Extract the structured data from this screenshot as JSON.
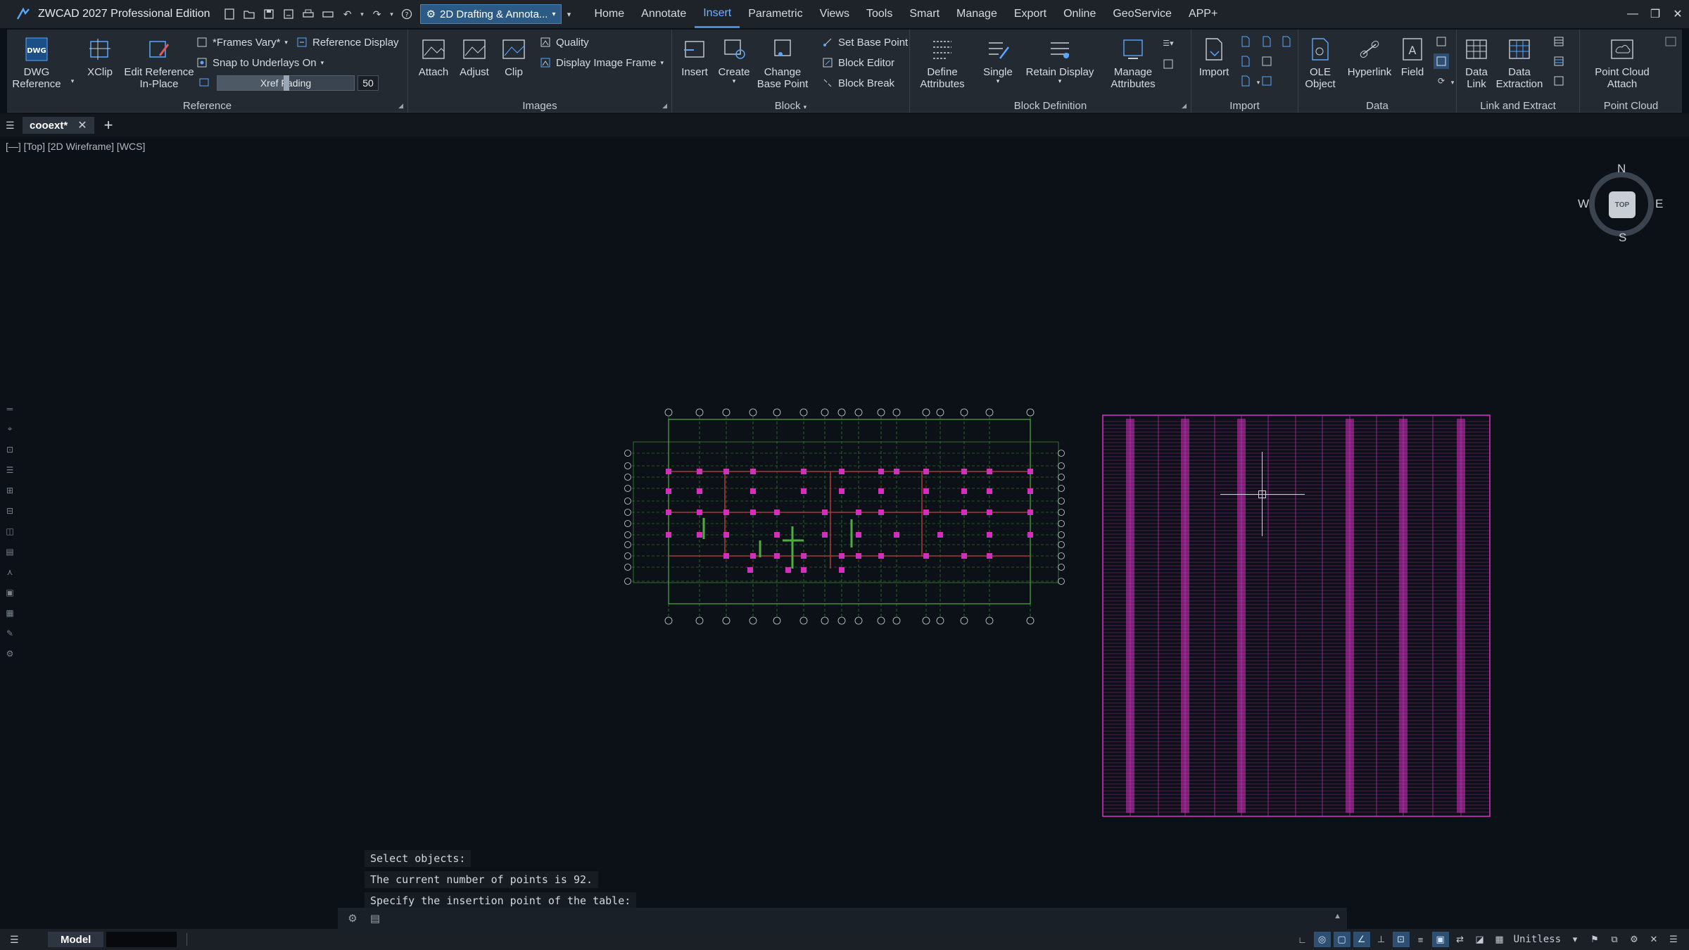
{
  "app": {
    "title": "ZWCAD 2027 Professional Edition"
  },
  "workspace": {
    "label": "2D Drafting & Annota..."
  },
  "menu": [
    "Home",
    "Annotate",
    "Insert",
    "Parametric",
    "Views",
    "Tools",
    "Smart",
    "Manage",
    "Export",
    "Online",
    "GeoService",
    "APP+"
  ],
  "menu_active": "Insert",
  "ribbon": {
    "reference": {
      "title": "Reference",
      "dwg_reference": "DWG\nReference",
      "xclip": "XClip",
      "edit_reference": "Edit Reference\nIn-Place",
      "frames": "*Frames Vary*",
      "reference_display": "Reference Display",
      "snap_underlays": "Snap to Underlays On",
      "xref_fading": {
        "label": "Xref Fading",
        "value": "50",
        "level_percent": 50
      }
    },
    "images": {
      "title": "Images",
      "attach": "Attach",
      "adjust": "Adjust",
      "clip": "Clip",
      "quality": "Quality",
      "display_image_frame": "Display Image Frame"
    },
    "block": {
      "title": "Block",
      "insert": "Insert",
      "create": "Create",
      "change_base_point": "Change\nBase Point",
      "set_base_point": "Set Base Point",
      "block_editor": "Block Editor",
      "block_break": "Block Break"
    },
    "block_definition": {
      "title": "Block Definition",
      "define_attributes": "Define\nAttributes",
      "single": "Single",
      "retain_display": "Retain Display",
      "manage_attributes": "Manage\nAttributes"
    },
    "import": {
      "title": "Import",
      "import": "Import"
    },
    "data": {
      "title": "Data",
      "ole_object": "OLE\nObject",
      "hyperlink": "Hyperlink",
      "field": "Field"
    },
    "link_extract": {
      "title": "Link and Extract",
      "data_link": "Data\nLink",
      "data_extraction": "Data\nExtraction"
    },
    "point_cloud": {
      "title": "Point Cloud",
      "attach": "Point Cloud\nAttach"
    }
  },
  "tabs": {
    "doc": "cooext*"
  },
  "viewport": {
    "label": "[—] [Top] [2D Wireframe] [WCS]"
  },
  "viewcube": {
    "n": "N",
    "s": "S",
    "e": "E",
    "w": "W",
    "face": "TOP"
  },
  "command": {
    "history": [
      "Select objects:",
      "The current number of points is 92.",
      "Specify the insertion point of the table:"
    ]
  },
  "status": {
    "model": "Model",
    "units": "Unitless"
  },
  "colors": {
    "accent": "#3d8fe4",
    "magenta": "#d22fbd",
    "green": "#4caf3a",
    "background": "#0b1117"
  },
  "icons": [
    "zw-logo-icon",
    "new-icon",
    "open-icon",
    "save-icon",
    "saveas-icon",
    "print-icon",
    "plot-icon",
    "undo-icon",
    "redo-icon",
    "help-icon",
    "gear-icon",
    "settings-icon"
  ]
}
